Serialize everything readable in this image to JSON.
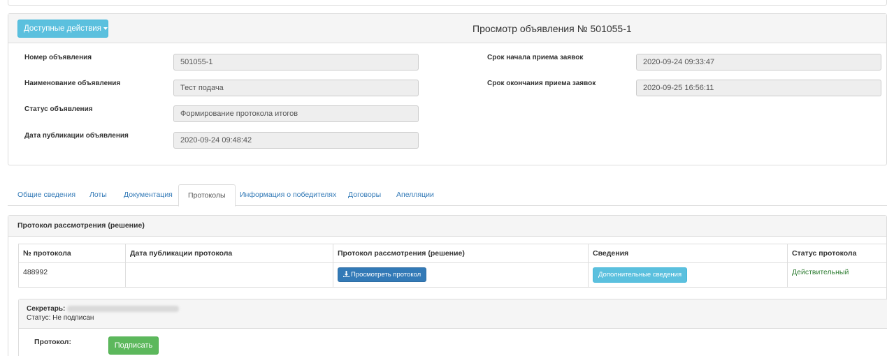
{
  "header": {
    "actions_label": "Доступные действия",
    "title": "Просмотр объявления № 501055-1"
  },
  "fields": {
    "number_label": "Номер объявления",
    "number_value": "501055-1",
    "name_label": "Наименование объявления",
    "name_value": "Тест подача",
    "status_label": "Статус объявления",
    "status_value": "Формирование протокола итогов",
    "pub_label": "Дата публикации объявления",
    "pub_value": "2020-09-24 09:48:42",
    "start_label": "Срок начала приема заявок",
    "start_value": "2020-09-24 09:33:47",
    "end_label": "Срок окончания приема заявок",
    "end_value": "2020-09-25 16:56:11"
  },
  "tabs": [
    {
      "label": "Общие сведения"
    },
    {
      "label": "Лоты"
    },
    {
      "label": "Документация"
    },
    {
      "label": "Протоколы"
    },
    {
      "label": "Информация о победителях"
    },
    {
      "label": "Договоры"
    },
    {
      "label": "Апелляции"
    }
  ],
  "protocol": {
    "heading": "Протокол рассмотрения (решение)",
    "columns": [
      "№ протокола",
      "Дата публикации протокола",
      "Протокол рассмотрения (решение)",
      "Сведения",
      "Статус протокола"
    ],
    "row": {
      "number": "488992",
      "date": "",
      "view_label": "Просмотреть протокол",
      "info_label": "Дополнительные сведения",
      "status": "Действительный"
    },
    "secretary_label": "Секретарь:",
    "sign_status": "Статус: Не подписан",
    "protocol_label": "Протокол:",
    "sign_label": "Подписать"
  },
  "colors": {
    "info": "#5bc0de",
    "primary": "#337ab7",
    "success": "#5cb85c",
    "status_ok": "#2e7d32"
  }
}
